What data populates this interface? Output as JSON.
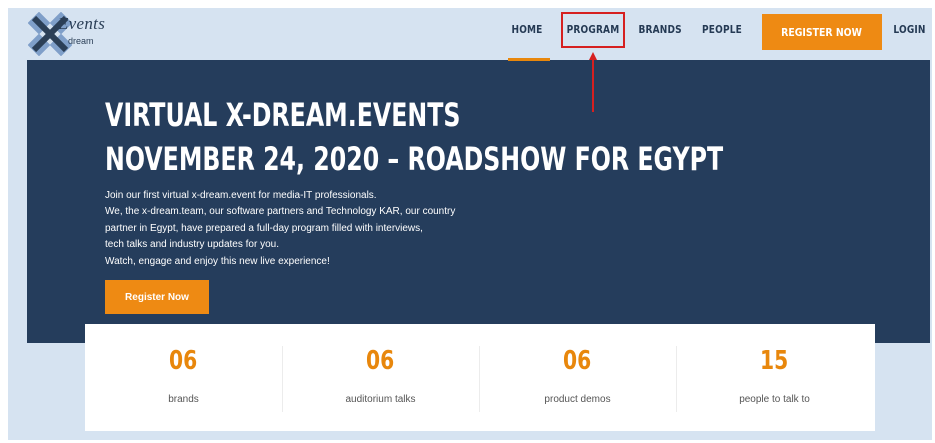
{
  "logo": {
    "events_text": "Events",
    "dream_text": "dream"
  },
  "nav": {
    "home": "HOME",
    "program": "PROGRAM",
    "brands": "BRANDS",
    "people": "PEOPLE",
    "register": "REGISTER NOW",
    "login": "LOGIN"
  },
  "hero": {
    "title_line1": "VIRTUAL X-DREAM.EVENTS",
    "title_line2": "NOVEMBER 24, 2020 – ROADSHOW FOR EGYPT",
    "description_lines": [
      "Join our first virtual x-dream.event for media-IT professionals.",
      "We, the x-dream.team, our software partners and Technology KAR, our country",
      "partner in Egypt, have prepared a full-day program filled with interviews,",
      "tech talks and industry updates for you.",
      "Watch, engage and enjoy this new live experience!"
    ],
    "register_button": "Register Now"
  },
  "stats": [
    {
      "value": "06",
      "label": "brands"
    },
    {
      "value": "06",
      "label": "auditorium talks"
    },
    {
      "value": "06",
      "label": "product demos"
    },
    {
      "value": "15",
      "label": "people to talk to"
    }
  ],
  "colors": {
    "accent": "#ee8a13",
    "hero_background": "#253d5c",
    "page_background": "#d6e3f1",
    "nav_text": "#253a54",
    "highlight_box": "#d62020"
  },
  "icons": {
    "logo_mark": "x-logo-icon",
    "annotation": "red-arrow-icon"
  }
}
